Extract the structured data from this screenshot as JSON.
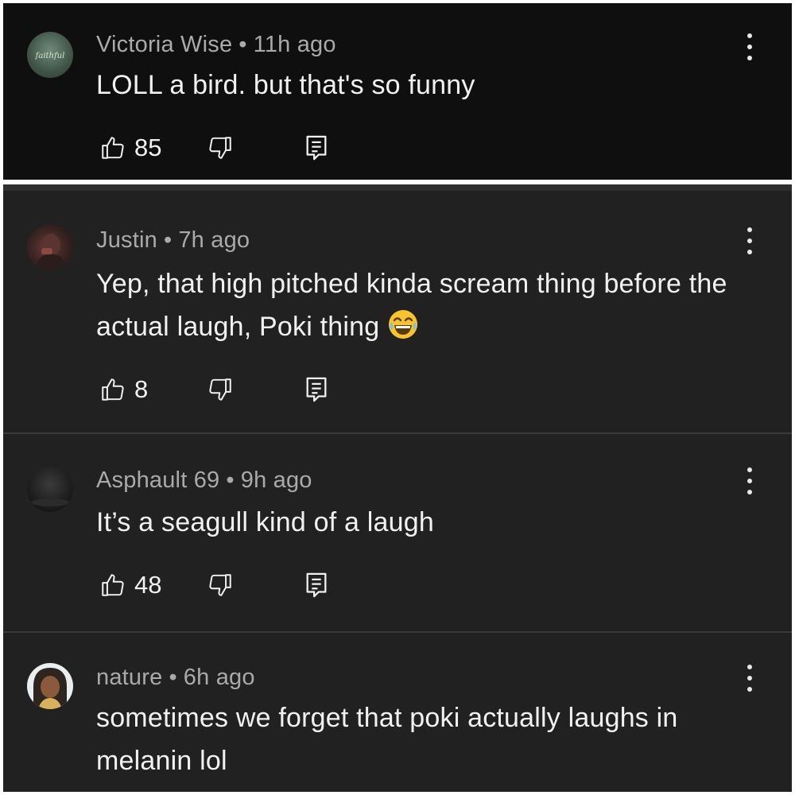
{
  "comments": [
    {
      "author": "Victoria Wise",
      "age": "11h ago",
      "text": "LOLL a bird. but that's so funny",
      "likes": "85",
      "avatar_text": "faithful"
    },
    {
      "author": "Justin",
      "age": "7h ago",
      "text": "Yep, that high pitched kinda scream thing before the actual laugh, Poki thing",
      "likes": "8"
    },
    {
      "author": "Asphault 69",
      "age": "9h ago",
      "text": "It’s a seagull kind of a laugh",
      "likes": "48"
    },
    {
      "author": "nature",
      "age": "6h ago",
      "text": "sometimes we forget that poki actually laughs in melanin lol"
    }
  ],
  "separator": "•",
  "icons": {
    "like": "thumbs-up-icon",
    "dislike": "thumbs-down-icon",
    "reply": "reply-icon",
    "more": "more-vertical-icon",
    "emoji": "face-with-tears-of-joy-emoji"
  }
}
